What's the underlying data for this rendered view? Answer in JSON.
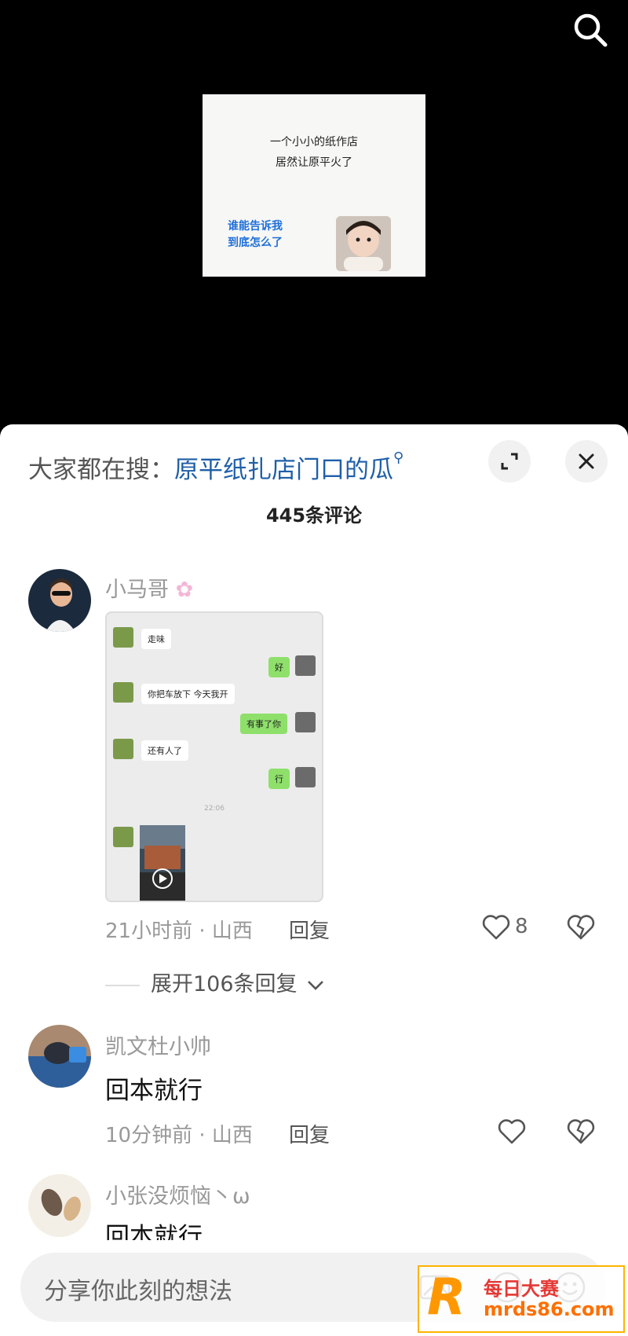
{
  "video": {
    "icons": [
      "search-icon"
    ],
    "thumbnail": {
      "line1": "一个小小的纸作店",
      "line2": "居然让原平火了",
      "caption_line1": "谁能告诉我",
      "caption_line2": "到底怎么了"
    }
  },
  "panel": {
    "hot_search_label": "大家都在搜：",
    "hot_search_query": "原平纸扎店门口的瓜",
    "comment_count": "445条评论",
    "icons": [
      "expand-icon",
      "close-icon"
    ]
  },
  "comments": [
    {
      "username": "小马哥",
      "text": "",
      "meta": "21小时前 · 山西",
      "reply_label": "回复",
      "likes": "8",
      "expand_replies": "展开106条回复",
      "image_chat": {
        "messages": [
          {
            "side": "left",
            "text": "走味"
          },
          {
            "side": "right",
            "text": "好"
          },
          {
            "side": "left",
            "text": "你把车放下   今天我开"
          },
          {
            "side": "right",
            "text": "有事了你"
          },
          {
            "side": "left",
            "text": "还有人了"
          },
          {
            "side": "right",
            "text": "行"
          }
        ],
        "timestamp": "22:06"
      }
    },
    {
      "username": "凯文杜小帅",
      "text": "回本就行",
      "meta": "10分钟前 · 山西",
      "reply_label": "回复",
      "likes": ""
    },
    {
      "username": "小张没烦恼丶ω",
      "text": "回本就行"
    }
  ],
  "input": {
    "placeholder": "分享你此刻的想法"
  },
  "watermark": {
    "letter": "R",
    "line1": "每日大赛",
    "line2": "mrds86.com"
  }
}
